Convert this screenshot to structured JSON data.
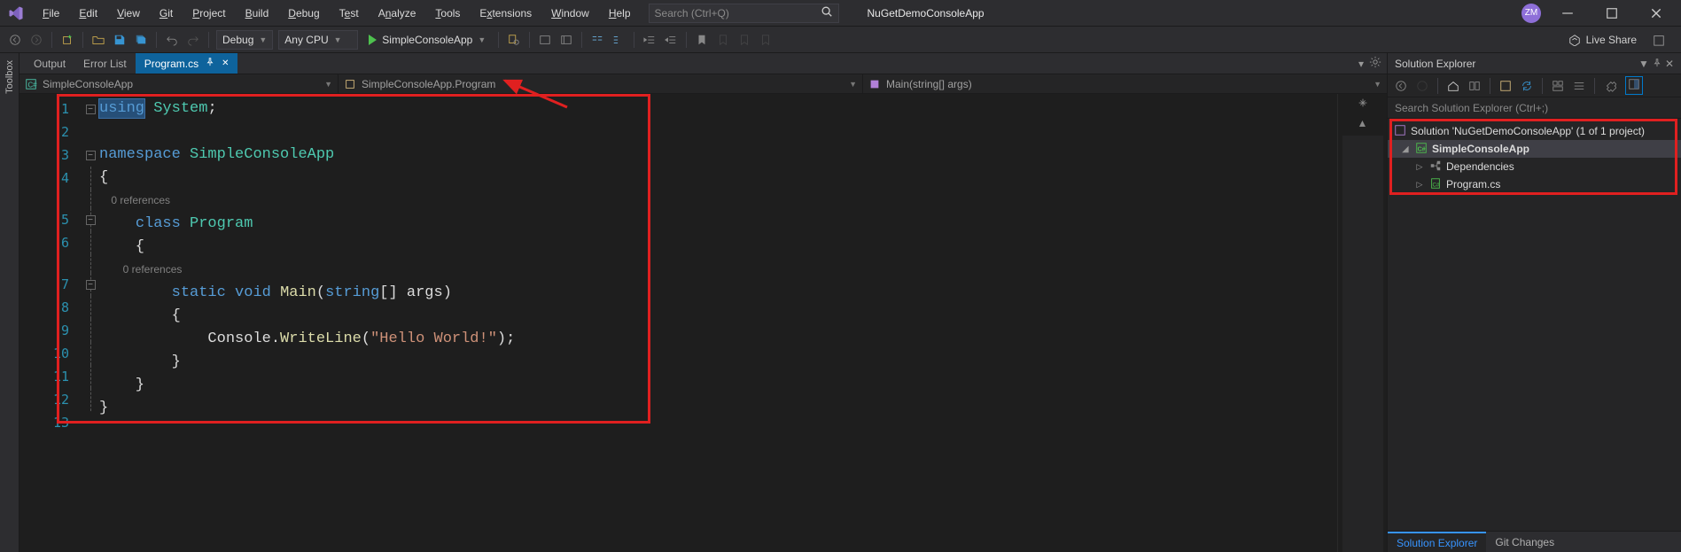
{
  "menubar": {
    "items": [
      {
        "label": "File",
        "ul": "F"
      },
      {
        "label": "Edit",
        "ul": "E"
      },
      {
        "label": "View",
        "ul": "V"
      },
      {
        "label": "Git",
        "ul": "G"
      },
      {
        "label": "Project",
        "ul": "P"
      },
      {
        "label": "Build",
        "ul": "B"
      },
      {
        "label": "Debug",
        "ul": "D"
      },
      {
        "label": "Test",
        "ul": "T"
      },
      {
        "label": "Analyze",
        "ul": "A"
      },
      {
        "label": "Tools",
        "ul": "T"
      },
      {
        "label": "Extensions",
        "ul": "E"
      },
      {
        "label": "Window",
        "ul": "W"
      },
      {
        "label": "Help",
        "ul": "H"
      }
    ],
    "search_placeholder": "Search (Ctrl+Q)",
    "app_name": "NuGetDemoConsoleApp",
    "avatar_initials": "ZM"
  },
  "toolbar": {
    "config_combo": "Debug",
    "platform_combo": "Any CPU",
    "run_target": "SimpleConsoleApp",
    "live_share": "Live Share"
  },
  "doc_tabs": {
    "tabs": [
      {
        "label": "Output",
        "active": false
      },
      {
        "label": "Error List",
        "active": false
      },
      {
        "label": "Program.cs",
        "active": true
      }
    ]
  },
  "navbar": {
    "seg1": "SimpleConsoleApp",
    "seg2": "SimpleConsoleApp.Program",
    "seg3": "Main(string[] args)"
  },
  "code": {
    "lines": [
      "1",
      "2",
      "3",
      "4",
      "5",
      "6",
      "7",
      "8",
      "9",
      "10",
      "11",
      "12",
      "13"
    ],
    "ref_note": "0 references",
    "l1_kw": "using",
    "l1_cls": "System",
    "l1_end": ";",
    "l3_kw": "namespace",
    "l3_cls": "SimpleConsoleApp",
    "l4": "{",
    "l5_kw": "class",
    "l5_cls": "Program",
    "l6": "    {",
    "l7_kw1": "static",
    "l7_kw2": "void",
    "l7_mth": "Main",
    "l7_open": "(",
    "l7_kw3": "string",
    "l7_arr": "[] ",
    "l7_arg": "args",
    "l7_close": ")",
    "l8": "        {",
    "l9_a": "            Console.",
    "l9_mth": "WriteLine",
    "l9_b": "(",
    "l9_str": "\"Hello World!\"",
    "l9_c": ");",
    "l10": "        }",
    "l11": "    }",
    "l12": "}"
  },
  "solution_explorer": {
    "title": "Solution Explorer",
    "search_placeholder": "Search Solution Explorer (Ctrl+;)",
    "solution_label": "Solution 'NuGetDemoConsoleApp' (1 of 1 project)",
    "project_label": "SimpleConsoleApp",
    "dep_label": "Dependencies",
    "program_label": "Program.cs",
    "bottom_tabs": {
      "a": "Solution Explorer",
      "b": "Git Changes"
    }
  }
}
